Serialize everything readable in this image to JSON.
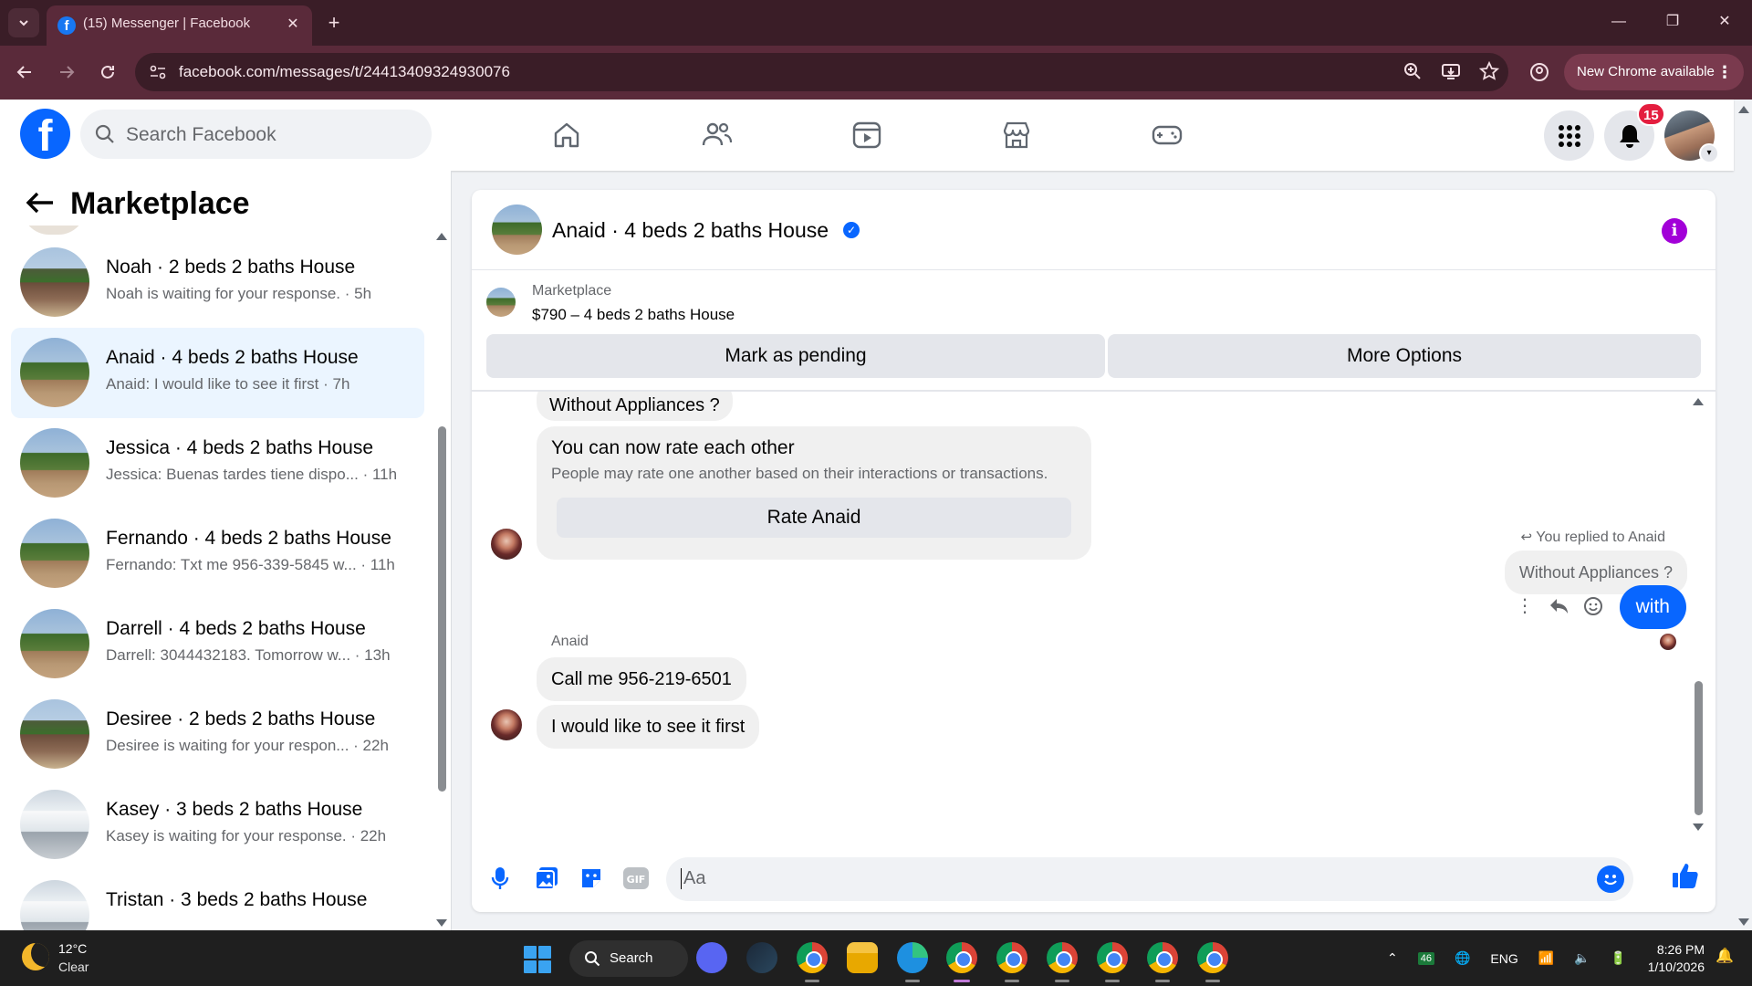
{
  "browser": {
    "tab_title": "(15) Messenger | Facebook",
    "url": "facebook.com/messages/t/24413409324930076",
    "new_chrome": "New Chrome available",
    "accent": "#5a2a3a"
  },
  "fb": {
    "search_placeholder": "Search Facebook",
    "notification_count": "15",
    "brand_color": "#0866ff",
    "nav": [
      "home-icon",
      "friends-icon",
      "video-icon",
      "marketplace-icon",
      "gaming-icon"
    ]
  },
  "left_panel": {
    "title": "Marketplace",
    "conversations": [
      {
        "name": "Noah · 2 beds 2 baths House",
        "snippet": "Noah is waiting for your response. · 5h",
        "thumb": "mobile"
      },
      {
        "name": "Anaid · 4 beds 2 baths House",
        "snippet": "Anaid: I would like to see it first · 7h",
        "thumb": "house",
        "active": true
      },
      {
        "name": "Jessica · 4 beds 2 baths House",
        "snippet": "Jessica: Buenas tardes tiene dispo...  · 11h",
        "thumb": "house"
      },
      {
        "name": "Fernando · 4 beds 2 baths House",
        "snippet": "Fernando: Txt me 956-339-5845 w...  · 11h",
        "thumb": "house"
      },
      {
        "name": "Darrell · 4 beds 2 baths House",
        "snippet": "Darrell: 3044432183. Tomorrow w...  · 13h",
        "thumb": "house"
      },
      {
        "name": "Desiree · 2 beds 2 baths House",
        "snippet": "Desiree is waiting for your respon...  · 22h",
        "thumb": "mobile"
      },
      {
        "name": "Kasey · 3 beds 2 baths House",
        "snippet": "Kasey is waiting for your response. · 22h",
        "thumb": "white"
      },
      {
        "name": "Tristan · 3 beds 2 baths House",
        "snippet": "",
        "thumb": "white"
      }
    ]
  },
  "chat": {
    "title": "Anaid · 4 beds 2 baths House",
    "marketplace_label": "Marketplace",
    "listing": "$790 – 4 beds 2 baths House",
    "mark_pending": "Mark as pending",
    "more_options": "More Options",
    "prev_message": "Without Appliances ?",
    "rate_title": "You can now rate each other",
    "rate_sub": "People may rate one another based on their interactions or transactions.",
    "rate_button": "Rate Anaid",
    "reply_hint": "You replied to Anaid",
    "reply_quote": "Without Appliances ?",
    "my_message": "with",
    "sender": "Anaid",
    "messages": [
      "Call me 956-219-6501",
      "I would like to see it first"
    ],
    "composer_placeholder": "Aa"
  },
  "taskbar": {
    "temp": "12°C",
    "weather": "Clear",
    "search": "Search",
    "lang": "ENG",
    "time": "8:26 PM",
    "date": "1/10/2026",
    "battery_badge": "46"
  }
}
